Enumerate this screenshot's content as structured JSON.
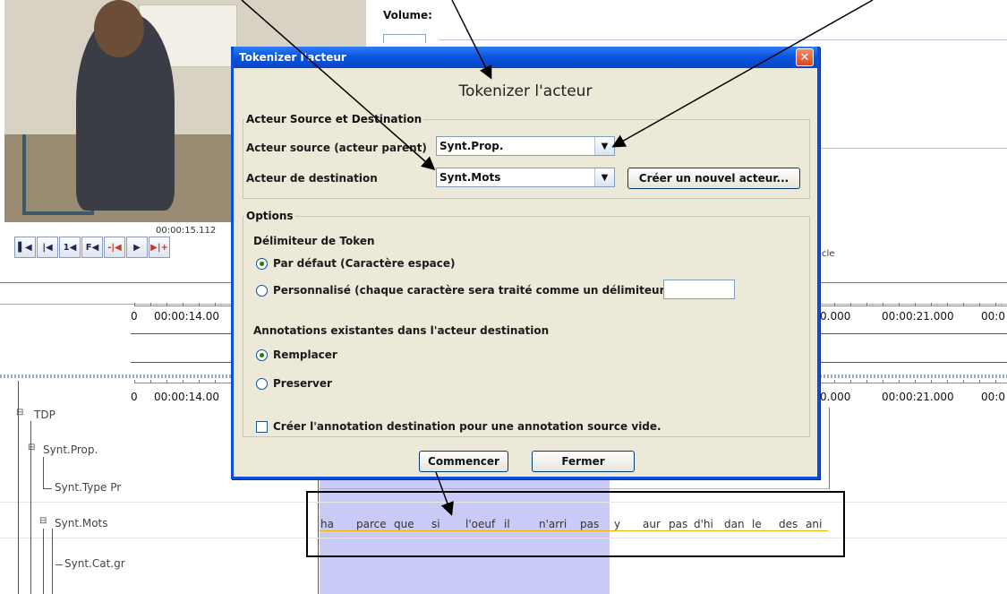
{
  "video": {
    "timecode": "00:00:15.112"
  },
  "transport": [
    "▌◀",
    "|◀",
    "1◀",
    "F◀",
    "-|◀",
    "▶",
    "▶|+"
  ],
  "volume": {
    "label": "Volume:"
  },
  "side_text": {
    "cycle": "cle"
  },
  "rulers": {
    "left_time": "00:00:14.00",
    "left_zero": "0",
    "right_a": "0.000",
    "right_b": "00:00:21.000",
    "right_c": "00:0"
  },
  "tiers": [
    {
      "label": "TDP"
    },
    {
      "label": "Synt.Prop."
    },
    {
      "label": "Synt.Type Pr"
    },
    {
      "label": "Synt.Mots"
    },
    {
      "label": "Synt.Cat.gr"
    }
  ],
  "tokens": [
    "ha",
    "parce",
    "que",
    "si",
    "l'oeuf",
    "il",
    "n'arri",
    "pas",
    "y",
    "aur",
    "pas",
    "d'hi",
    "dan",
    "le",
    "des",
    "ani"
  ],
  "dialog": {
    "title": "Tokenizer l'acteur",
    "heading": "Tokenizer l'acteur",
    "source_group": {
      "legend": "Acteur Source et Destination",
      "source_label": "Acteur source (acteur parent)",
      "source_value": "Synt.Prop.",
      "dest_label": "Acteur de destination",
      "dest_value": "Synt.Mots",
      "new_actor_button": "Créer un nouvel acteur..."
    },
    "options_group": {
      "legend": "Options",
      "delimiter_heading": "Délimiteur de Token",
      "default_option": "Par défaut (Caractère espace)",
      "custom_option": "Personnalisé (chaque caractère sera traité comme un délimiteur)",
      "existing_heading": "Annotations existantes dans l'acteur destination",
      "replace_option": "Remplacer",
      "preserve_option": "Preserver",
      "empty_checkbox": "Créer l'annotation destination pour une annotation source vide."
    },
    "start_button": "Commencer",
    "close_button": "Fermer"
  }
}
